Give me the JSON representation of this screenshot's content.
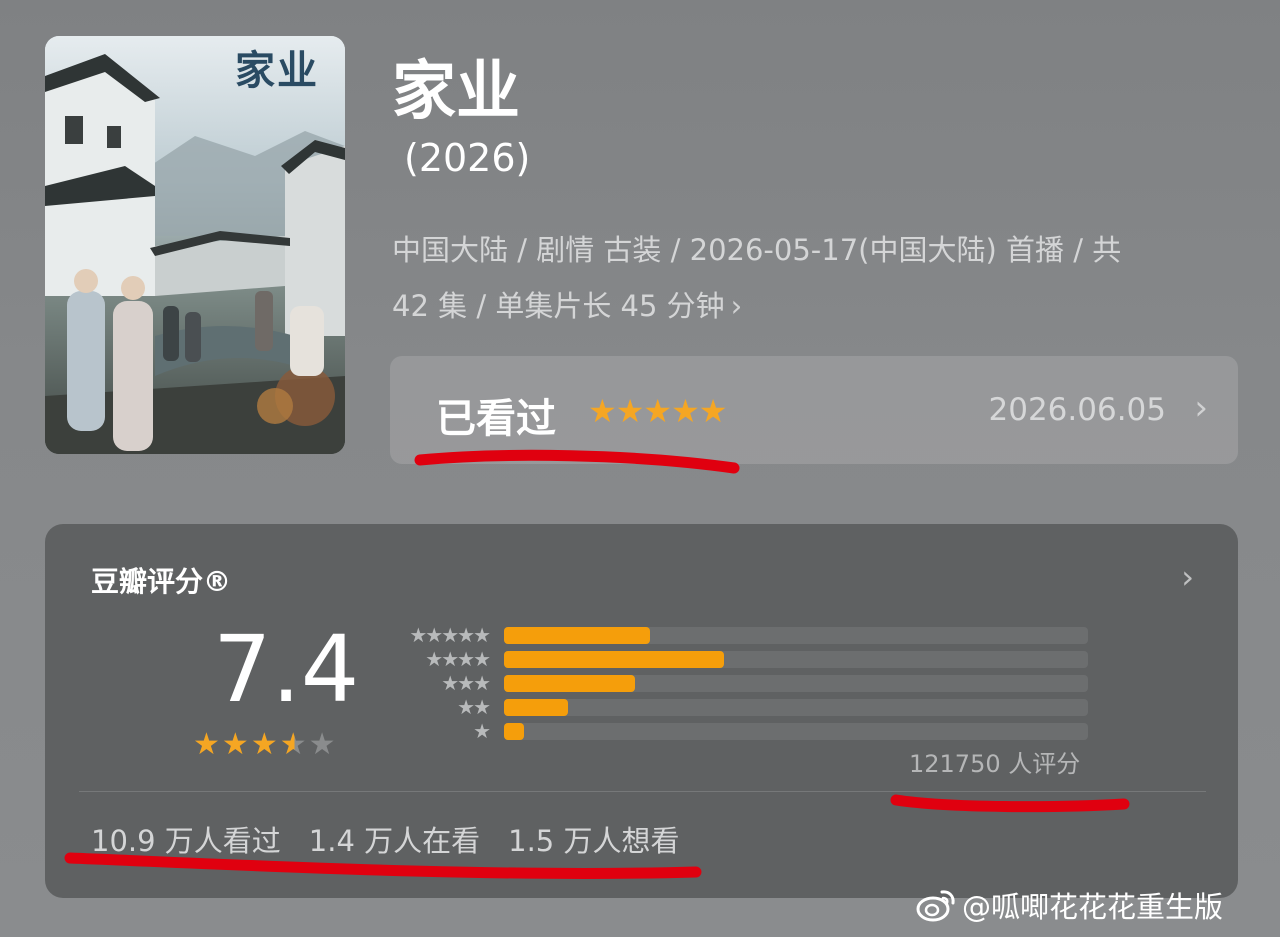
{
  "poster": {
    "title": "家业"
  },
  "title": "家业",
  "year": "(2026)",
  "meta": {
    "line1": "中国大陆 / 剧情 古装 / 2026-05-17(中国大陆) 首播 / 共",
    "line2": "42 集 / 单集片长 45 分钟",
    "chevron": "›"
  },
  "watched": {
    "label": "已看过",
    "stars": "★★★★★",
    "user_rating": 5,
    "date": "2026.06.05",
    "chevron": "›"
  },
  "rating_card": {
    "title": "豆瓣评分®",
    "chevron": "›",
    "score": "7.4",
    "score_stars_filled": 3.5,
    "distribution": [
      {
        "stars": "★★★★★",
        "fraction": 0.25
      },
      {
        "stars": "★★★★",
        "fraction": 0.376
      },
      {
        "stars": "★★★",
        "fraction": 0.224
      },
      {
        "stars": "★★",
        "fraction": 0.109
      },
      {
        "stars": "★",
        "fraction": 0.035
      }
    ],
    "raters": "121750 人评分",
    "counts": [
      "10.9 万人看过",
      "1.4 万人在看",
      "1.5 万人想看"
    ]
  },
  "watermark": {
    "text": "@呱唧花花花重生版",
    "icon": "weibo-icon"
  },
  "colors": {
    "accent": "#f59e0b",
    "highlight_mark": "#e0000f"
  }
}
